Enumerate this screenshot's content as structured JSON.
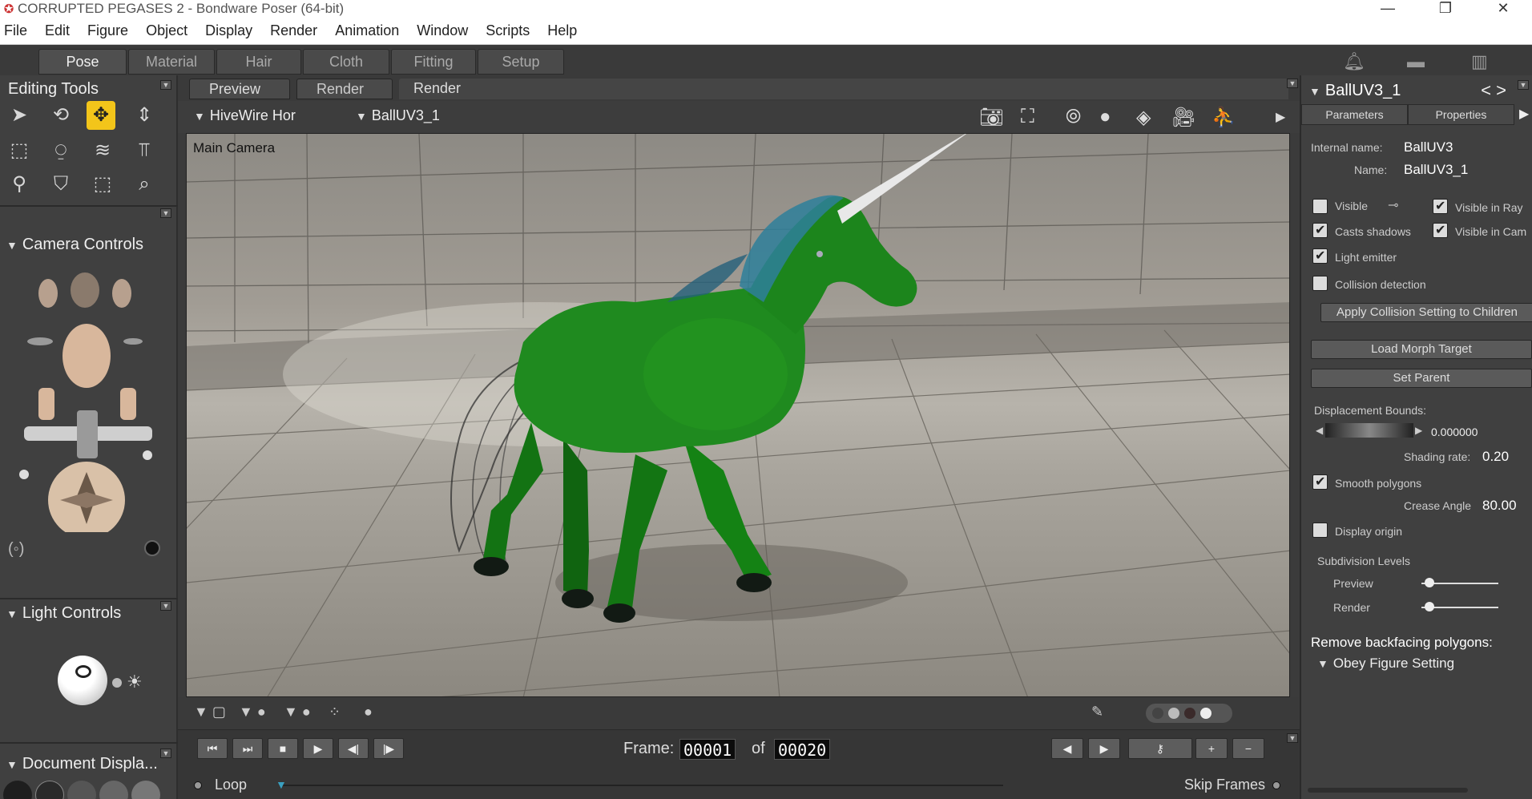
{
  "window": {
    "title": "CORRUPTED PEGASES 2 - Bondware Poser (64-bit)",
    "minimize": "—",
    "restore": "❐",
    "close": "✕"
  },
  "menu": [
    "File",
    "Edit",
    "Figure",
    "Object",
    "Display",
    "Render",
    "Animation",
    "Window",
    "Scripts",
    "Help"
  ],
  "rooms": {
    "pose": "Pose",
    "material": "Material",
    "hair": "Hair",
    "cloth": "Cloth",
    "fitting": "Fitting",
    "setup": "Setup"
  },
  "left": {
    "editing_tools": "Editing Tools",
    "camera_controls": "Camera Controls",
    "light_controls": "Light Controls",
    "document_display": "Document Displa..."
  },
  "viewport": {
    "tab_preview": "Preview",
    "tab_render": "Render",
    "tab_render2": "Render",
    "figure_select": "HiveWire Hor",
    "actor_select": "BallUV3_1",
    "camera_label": "Main Camera"
  },
  "animation": {
    "frame_label": "Frame:",
    "current_frame": "00001",
    "of_label": "of",
    "total_frames": "00020",
    "loop_label": "Loop",
    "skip_label": "Skip Frames"
  },
  "properties": {
    "title": "BallUV3_1",
    "tab_parameters": "Parameters",
    "tab_properties": "Properties",
    "internal_name_label": "Internal name:",
    "internal_name": "BallUV3",
    "name_label": "Name:",
    "name": "BallUV3_1",
    "visible": "Visible",
    "visible_in_ray": "Visible in Ray",
    "casts_shadows": "Casts shadows",
    "visible_in_cam": "Visible in Cam",
    "light_emitter": "Light emitter",
    "collision_detection": "Collision detection",
    "apply_collision": "Apply Collision Setting to Children",
    "load_morph": "Load Morph Target",
    "set_parent": "Set Parent",
    "displacement_bounds": "Displacement Bounds:",
    "displacement_value": "0.000000",
    "shading_rate_label": "Shading rate:",
    "shading_rate": "0.20",
    "smooth_polygons": "Smooth polygons",
    "crease_angle_label": "Crease Angle",
    "crease_angle": "80.00",
    "display_origin": "Display origin",
    "subdivision_levels": "Subdivision Levels",
    "preview_label": "Preview",
    "render_label": "Render",
    "remove_backfacing": "Remove backfacing polygons:",
    "obey_figure": "Obey Figure Setting"
  },
  "colors": {
    "accent_tool": "#f3c51a",
    "horse_green": "#1f8a1f",
    "mane_blue": "#2e7f9a"
  }
}
